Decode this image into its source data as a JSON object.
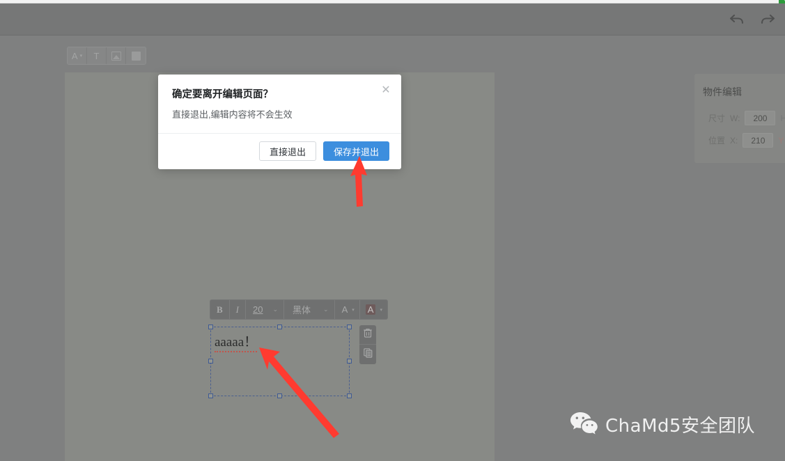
{
  "top_bar": {
    "undo_icon": "undo-arrow-icon",
    "redo_icon": "redo-arrow-icon"
  },
  "shape_toolbar": {
    "items": [
      {
        "label": "A",
        "icon": "text-style-icon",
        "caret": "▾"
      },
      {
        "label": "T",
        "icon": "text-insert-icon"
      },
      {
        "label": "",
        "icon": "image-insert-icon"
      },
      {
        "label": "",
        "icon": "shape-insert-icon"
      }
    ]
  },
  "properties_panel": {
    "title": "物件编辑",
    "rows": [
      {
        "label": "尺寸",
        "axis": "W:",
        "value": "200",
        "tail": "H"
      },
      {
        "label": "位置",
        "axis": "X:",
        "value": "210",
        "tail": "Y"
      }
    ]
  },
  "text_toolbar": {
    "bold": "B",
    "italic": "I",
    "font_size": "20",
    "font_size_caret": "⌄",
    "font_family": "黑体",
    "font_family_caret": "⌄",
    "font_color_label": "A",
    "font_color_caret": "▾",
    "highlight_label": "A",
    "highlight_caret": "▾"
  },
  "text_element": {
    "content": "aaaaa！",
    "delete_icon": "trash-icon",
    "duplicate_icon": "duplicate-icon"
  },
  "dialog": {
    "title": "确定要离开编辑页面？",
    "message": "直接退出,编辑内容将不会生效",
    "close_icon": "✕",
    "cancel_label": "直接退出",
    "confirm_label": "保存并退出"
  },
  "watermark": {
    "text": "ChaMd5安全团队",
    "icon": "wechat-icon"
  },
  "colors": {
    "primary_button": "#3c8ede",
    "annotation_arrow": "#ff3b30",
    "canvas_background": "#888a86",
    "page_background": "#7f8080",
    "selection_border": "#4a5f8f"
  }
}
